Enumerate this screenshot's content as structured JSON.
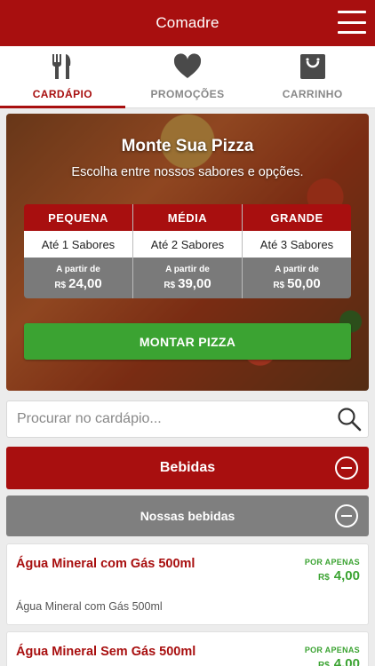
{
  "header": {
    "title": "Comadre"
  },
  "tabs": [
    {
      "label": "CARDÁPIO",
      "icon": "cutlery-icon",
      "active": true
    },
    {
      "label": "PROMOÇÕES",
      "icon": "heart-icon",
      "active": false
    },
    {
      "label": "CARRINHO",
      "icon": "shopping-bag-icon",
      "active": false
    }
  ],
  "hero": {
    "title": "Monte Sua Pizza",
    "subtitle": "Escolha entre nossos sabores e opções.",
    "sizes": [
      {
        "name": "PEQUENA",
        "flavors": "Até 1 Sabores",
        "from": "A partir de",
        "currency": "R$",
        "price": "24,00"
      },
      {
        "name": "MÉDIA",
        "flavors": "Até 2 Sabores",
        "from": "A partir de",
        "currency": "R$",
        "price": "39,00"
      },
      {
        "name": "GRANDE",
        "flavors": "Até 3 Sabores",
        "from": "A partir de",
        "currency": "R$",
        "price": "50,00"
      }
    ],
    "button_label": "MONTAR PIZZA"
  },
  "search": {
    "placeholder": "Procurar no cardápio..."
  },
  "category": {
    "title": "Bebidas"
  },
  "subcategory": {
    "title": "Nossas bebidas"
  },
  "items": [
    {
      "name": "Água Mineral com Gás 500ml",
      "description": "Água Mineral com Gás 500ml",
      "price_label": "POR APENAS",
      "currency": "R$",
      "price": "4,00"
    },
    {
      "name": "Água Mineral Sem Gás 500ml",
      "description": "",
      "price_label": "POR APENAS",
      "currency": "R$",
      "price": "4,00"
    }
  ],
  "colors": {
    "primary": "#a80f0f",
    "accent": "#3ba332",
    "gray": "#7f7f7f"
  }
}
